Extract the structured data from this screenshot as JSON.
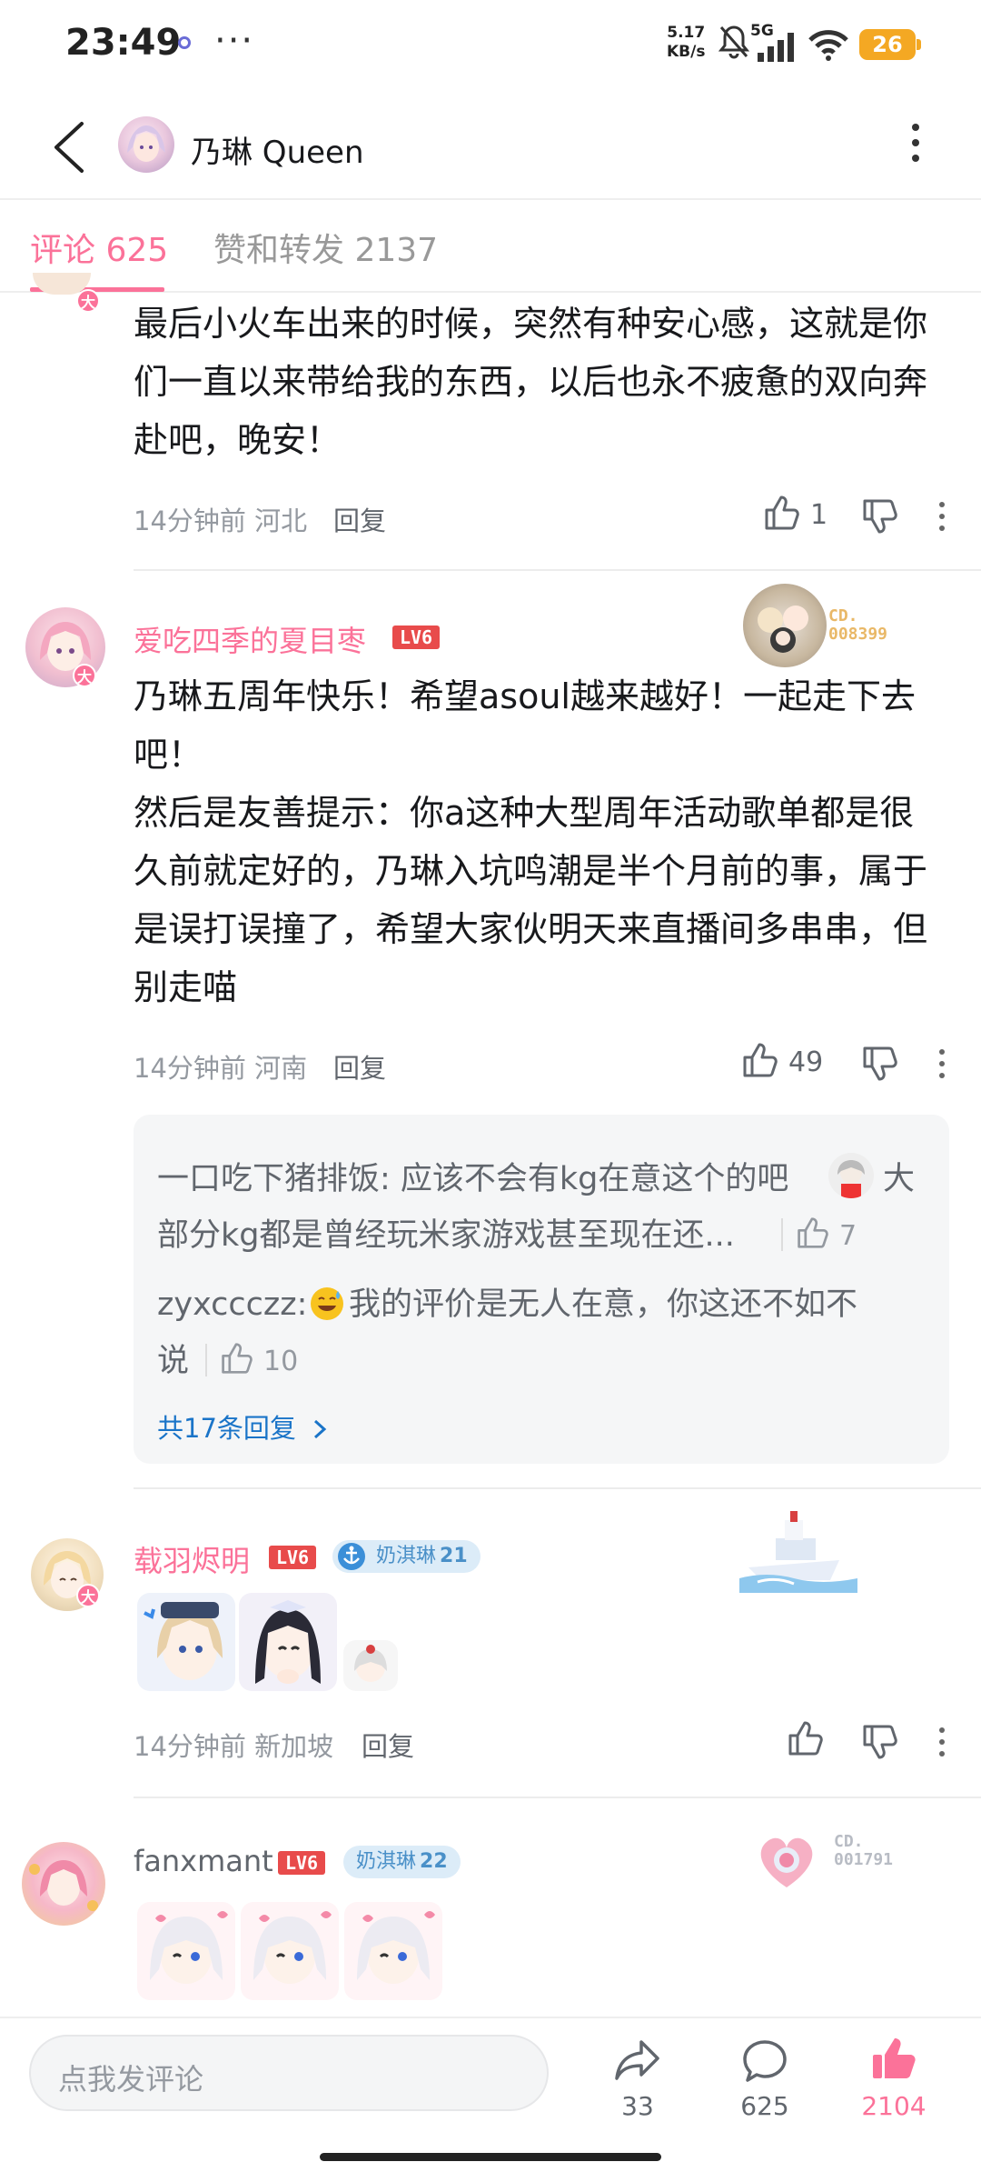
{
  "status_bar": {
    "time": "23:49",
    "dots": "···",
    "speed_value": "5.17",
    "speed_unit": "KB/s",
    "network": "5G",
    "battery": "26"
  },
  "header": {
    "title": "乃琳 Queen"
  },
  "tabs": [
    {
      "label": "评论 625",
      "active": true
    },
    {
      "label": "赞和转发 2137",
      "active": false
    }
  ],
  "comments": [
    {
      "text_lines": [
        "最后小火车出来的时候，突然有种安心感，这就是你",
        "们一直以来带给我的东西，以后也永不疲惫的双向奔",
        "赴吧，晚安！"
      ],
      "time": "14分钟前",
      "location": "河北",
      "reply_label": "回复",
      "likes": "1"
    },
    {
      "username": "爱吃四季的夏目枣",
      "level": "LV6",
      "badge_label": "大",
      "card_text": "CD.",
      "card_no": "008399",
      "text_lines": [
        "乃琳五周年快乐！希望asoul越来越好！一起走下去",
        "吧！",
        "然后是友善提示：你a这种大型周年活动歌单都是很",
        "久前就定好的，乃琳入坑鸣潮是半个月前的事，属于",
        "是误打误撞了，希望大家伙明天来直播间多串串，但",
        "别走喵"
      ],
      "time": "14分钟前",
      "location": "河南",
      "reply_label": "回复",
      "likes": "49",
      "replies": [
        {
          "line1": "一口吃下猪排饭: 应该不会有kg在意这个的吧",
          "line1_tail": "大",
          "line2": "部分kg都是曾经玩米家游戏甚至现在还...",
          "likes": "7"
        },
        {
          "line1": "zyxccczz:",
          "line1_tail": "我的评价是无人在意，你这还不如不",
          "line2": "说",
          "likes": "10"
        }
      ],
      "more_replies": "共17条回复"
    },
    {
      "username": "载羽烬明",
      "level": "LV6",
      "badge_label": "大",
      "medal_name": "奶淇琳",
      "medal_level": "21",
      "time": "14分钟前",
      "location": "新加坡",
      "reply_label": "回复"
    },
    {
      "username": "fanxmant",
      "level": "LV6",
      "medal_name": "奶淇琳",
      "medal_level": "22",
      "card_text": "CD.",
      "card_no": "001791"
    }
  ],
  "bottom_bar": {
    "input_placeholder": "点我发评论",
    "share_count": "33",
    "comment_count": "625",
    "like_count": "2104"
  },
  "colors": {
    "accent_pink": "#fb7299",
    "link_blue": "#1a74c8",
    "level_red": "#e84b4b",
    "battery": "#f4a823"
  }
}
